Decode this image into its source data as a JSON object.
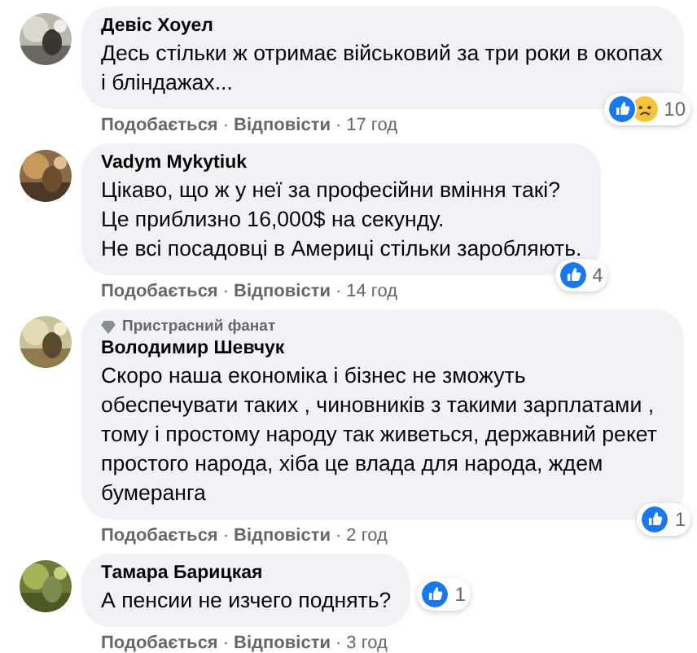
{
  "comments": [
    {
      "author": "Девіс Хоуел",
      "text": "Десь стільки ж отримає військовий за три роки в окопах і бліндажах...",
      "reactions": [
        {
          "kind": "like"
        },
        {
          "kind": "sad"
        }
      ],
      "count": "10",
      "like": "Подобається",
      "separator": "·",
      "reply": "Відповісти",
      "time": "17 год"
    },
    {
      "author": "Vadym Mykytiuk",
      "text": "Цікаво, що ж у неї за професійни вміння такі?\nЦе приблизно 16,000$ на секунду.\nНе всі посадовці в Америці стільки заробляють.",
      "reactions": [
        {
          "kind": "like"
        }
      ],
      "count": "4",
      "like": "Подобається",
      "separator": "·",
      "reply": "Відповісти",
      "time": "14 год"
    },
    {
      "badge": "Пристрасний фанат",
      "author": "Володимир Шевчук",
      "text": "Скоро наша економіка і бізнес не зможуть обеспечувати таких , чиновників з такими зарплатами , тому і простому народу так живеться, державний рекет простого народа, хіба це влада для народа, ждем бумеранга",
      "reactions": [
        {
          "kind": "like"
        }
      ],
      "count": "1",
      "like": "Подобається",
      "separator": "·",
      "reply": "Відповісти",
      "time": "2 год"
    },
    {
      "author": "Тамара Барицкая",
      "text": "А пенсии не изчего поднять?",
      "reactions": [
        {
          "kind": "like"
        }
      ],
      "count": "1",
      "like": "Подобається",
      "separator": "·",
      "reply": "Відповісти",
      "time": "3 год"
    }
  ]
}
